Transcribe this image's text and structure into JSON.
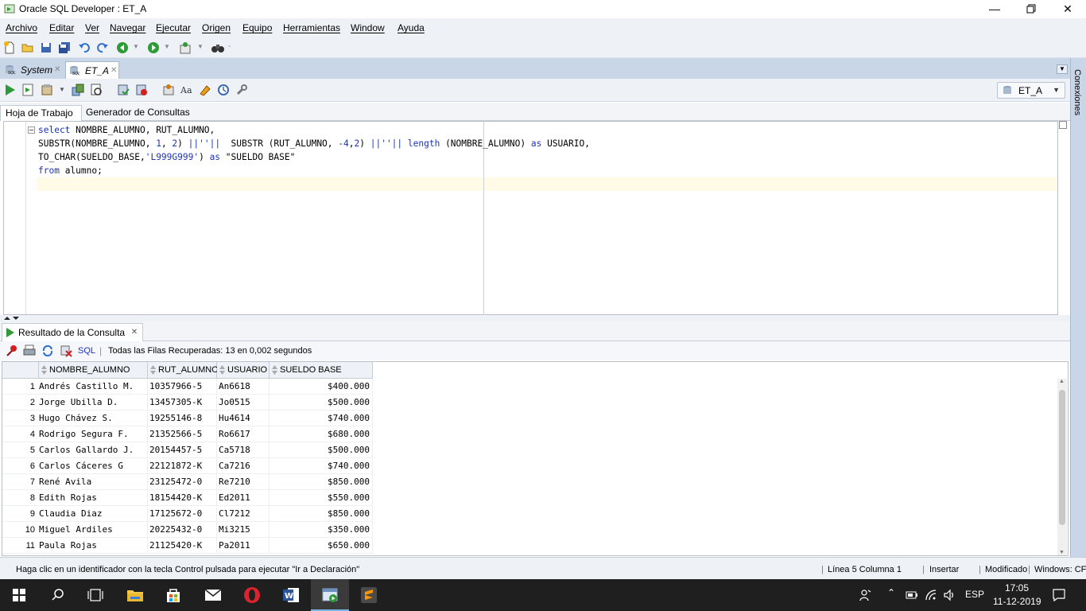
{
  "window": {
    "title": "Oracle SQL Developer : ET_A"
  },
  "menu": [
    "Archivo",
    "Editar",
    "Ver",
    "Navegar",
    "Ejecutar",
    "Origen",
    "Equipo",
    "Herramientas",
    "Window",
    "Ayuda"
  ],
  "doc_tabs": [
    {
      "label": "System"
    },
    {
      "label": "ET_A",
      "active": true
    }
  ],
  "side_panel_label": "Conexiones",
  "connection": "ET_A",
  "sub_tabs": [
    "Hoja de Trabajo",
    "Generador de Consultas"
  ],
  "results": {
    "tab_label": "Resultado de la Consulta",
    "sql_link": "SQL",
    "status": "Todas las Filas Recuperadas: 13 en 0,002 segundos",
    "columns": [
      "NOMBRE_ALUMNO",
      "RUT_ALUMNO",
      "USUARIO",
      "SUELDO BASE"
    ],
    "rows": [
      [
        "1",
        "Andrés Castillo M.",
        "10357966-5",
        "An6618",
        "$400.000"
      ],
      [
        "2",
        "Jorge Ubilla D.",
        "13457305-K",
        "Jo0515",
        "$500.000"
      ],
      [
        "3",
        "Hugo Chávez S.",
        "19255146-8",
        "Hu4614",
        "$740.000"
      ],
      [
        "4",
        "Rodrigo Segura F.",
        "21352566-5",
        "Ro6617",
        "$680.000"
      ],
      [
        "5",
        "Carlos Gallardo J.",
        "20154457-5",
        "Ca5718",
        "$500.000"
      ],
      [
        "6",
        "Carlos Cáceres G",
        "22121872-K",
        "Ca7216",
        "$740.000"
      ],
      [
        "7",
        "René Avila",
        "23125472-0",
        "Re7210",
        "$850.000"
      ],
      [
        "8",
        "Edith Rojas",
        "18154420-K",
        "Ed2011",
        "$550.000"
      ],
      [
        "9",
        "Claudia Diaz",
        "17125672-0",
        "Cl7212",
        "$850.000"
      ],
      [
        "10",
        "Miguel Ardiles",
        "20225432-0",
        "Mi3215",
        "$350.000"
      ],
      [
        "11",
        "Paula Rojas",
        "21125420-K",
        "Pa2011",
        "$650.000"
      ]
    ]
  },
  "status_bar": {
    "hint": "Haga clic en un identificador con la tecla Control pulsada para ejecutar \"Ir a Declaración\"",
    "position": "Línea 5 Columna 1",
    "mode": "Insertar",
    "modified": "Modificado",
    "eol": "Windows: CF"
  },
  "taskbar": {
    "lang": "ESP",
    "time": "17:05",
    "date": "11-12-2019"
  },
  "colors": {
    "keyword": "#1c34b8",
    "accent": "#c9d6e8"
  }
}
